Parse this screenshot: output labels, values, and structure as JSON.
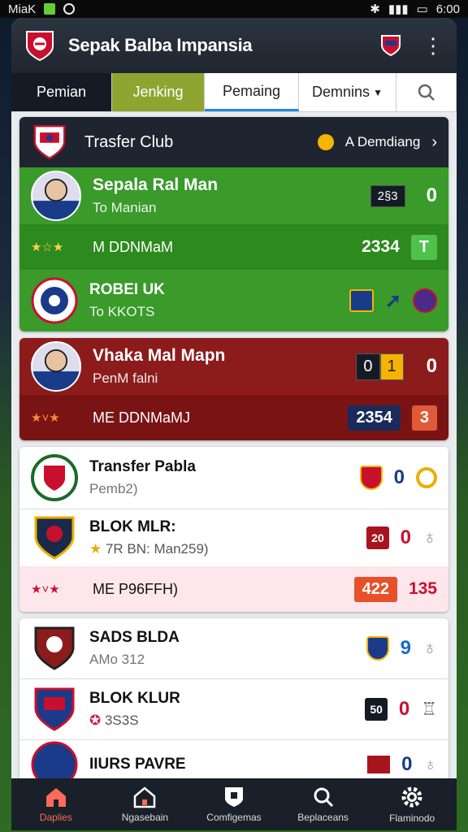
{
  "status_bar": {
    "left_text": "MiaK",
    "time": "6:00"
  },
  "app": {
    "title": "Sepak Balba Impansia"
  },
  "tabs": [
    "Pemian",
    "Jenking",
    "Pemaing",
    "Demnins"
  ],
  "header_card": {
    "title": "Trasfer Club",
    "action": "A Demdiang"
  },
  "player1": {
    "name": "Sepala Ral Man",
    "position": "To Manian",
    "score_box": "2§3",
    "score": "0",
    "stat": "M DDNMaM",
    "value": "2334",
    "badge": "T"
  },
  "club1": {
    "name": "ROBEI UK",
    "sub": "To KKOTS"
  },
  "player2": {
    "name": "Vhaka Mal Mapn",
    "position": "PenM falni",
    "score_box": "0",
    "score_box2": "1",
    "score": "0",
    "stat": "ME DDNMaMJ",
    "value": "2354",
    "badge": "3"
  },
  "club2": {
    "name": "Transfer Pabla",
    "sub": "Pemb2)",
    "score": "0"
  },
  "club3": {
    "name": "BLOK MLR:",
    "sub": "7R BN: Man259)",
    "badge": "20",
    "score": "0",
    "stat": "ME P96FFH)",
    "value1": "422",
    "value2": "135"
  },
  "club4": {
    "name": "SADS BLDA",
    "sub": "AMo 312",
    "score": "9"
  },
  "club5": {
    "name": "BLOK KLUR",
    "sub": "3S3S",
    "badge": "50",
    "score": "0"
  },
  "club6": {
    "name": "IIURS PAVRE",
    "sub": "",
    "badge": "",
    "score": "0"
  },
  "nav": [
    "Daplies",
    "Ngasebain",
    "Comfigemas",
    "Beplaceans",
    "Flaminodo"
  ],
  "colors": {
    "green": "#3a9a2a",
    "red": "#8c1c1c",
    "accent": "#ff6a5a",
    "tab_active": "#8fa431"
  }
}
